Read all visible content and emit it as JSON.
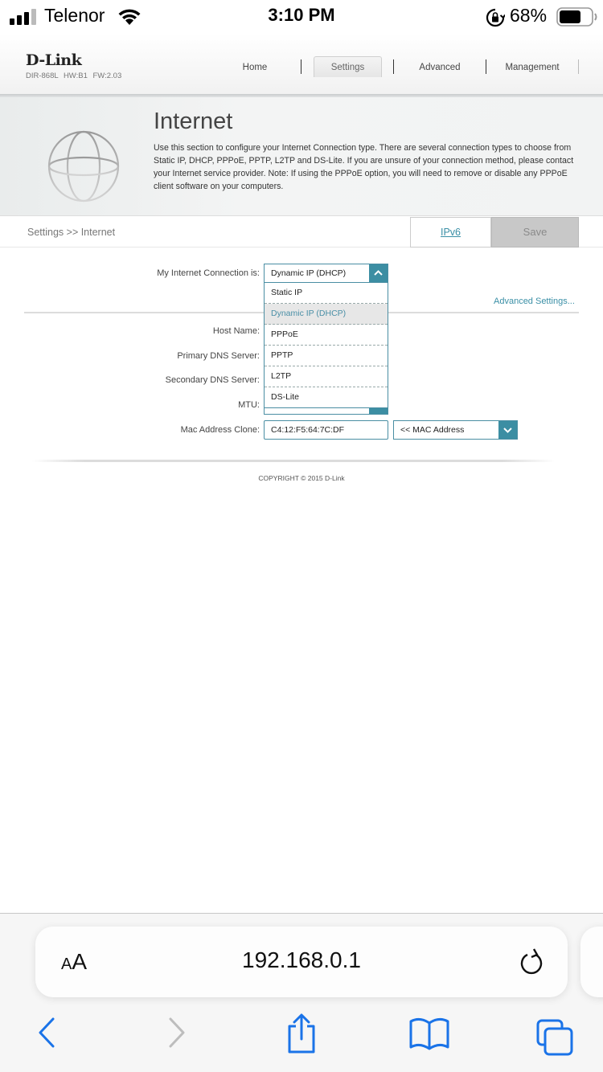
{
  "status_bar": {
    "carrier": "Telenor",
    "time": "3:10 PM",
    "battery_percent": "68%",
    "signal_bars": 3,
    "battery_level": 0.68
  },
  "router": {
    "brand": "D-Link",
    "model_info": "DIR-868L   HW:B1   FW:2.03",
    "nav": [
      {
        "label": "Home",
        "active": false
      },
      {
        "label": "Settings",
        "active": true
      },
      {
        "label": "Advanced",
        "active": false
      },
      {
        "label": "Management",
        "active": false
      }
    ]
  },
  "section": {
    "title": "Internet",
    "description": "Use this section to configure your Internet Connection type. There are several connection types to choose from Static IP, DHCP, PPPoE, PPTP, L2TP and DS-Lite. If you are unsure of your connection method, please contact your Internet service provider. Note: If using the PPPoE option, you will need to remove or disable any PPPoE client software on your computers."
  },
  "breadcrumb": "Settings >> Internet",
  "buttons": {
    "ipv6": "IPv6",
    "save": "Save"
  },
  "form": {
    "connection_label": "My Internet Connection is:",
    "connection_value": "Dynamic IP (DHCP)",
    "connection_options": [
      {
        "label": "Static IP",
        "selected": false
      },
      {
        "label": "Dynamic IP (DHCP)",
        "selected": true
      },
      {
        "label": "PPPoE",
        "selected": false
      },
      {
        "label": "PPTP",
        "selected": false
      },
      {
        "label": "L2TP",
        "selected": false
      },
      {
        "label": "DS-Lite",
        "selected": false
      }
    ],
    "advanced_link": "Advanced Settings...",
    "host_name_label": "Host Name:",
    "primary_dns_label": "Primary DNS Server:",
    "secondary_dns_label": "Secondary DNS Server:",
    "mtu_label": "MTU:",
    "mac_clone_label": "Mac Address Clone:",
    "mac_clone_value": "C4:12:F5:64:7C:DF",
    "mac_select_value": "<< MAC Address"
  },
  "footer": {
    "copyright": "COPYRIGHT © 2015 D-Link"
  },
  "safari": {
    "text_size_label_small": "A",
    "text_size_label_large": "A",
    "url": "192.168.0.1"
  },
  "colors": {
    "accent": "#3c8ea3",
    "link": "#3a8fa6",
    "ios_blue": "#1a73e8"
  }
}
